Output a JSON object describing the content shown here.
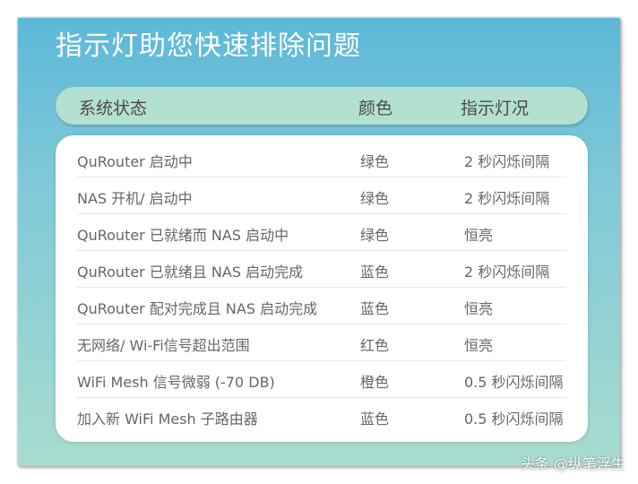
{
  "title": "指示灯助您快速排除问题",
  "header": {
    "col1": "系统状态",
    "col2": "颜色",
    "col3": "指示灯况"
  },
  "rows": [
    {
      "status": "QuRouter 启动中",
      "color": "绿色",
      "light": "2 秒闪烁间隔"
    },
    {
      "status": "NAS 开机/ 启动中",
      "color": "绿色",
      "light": "2 秒闪烁间隔"
    },
    {
      "status": "QuRouter 已就绪而 NAS 启动中",
      "color": "绿色",
      "light": "恒亮"
    },
    {
      "status": "QuRouter 已就绪且 NAS 启动完成",
      "color": "蓝色",
      "light": "2 秒闪烁间隔"
    },
    {
      "status": "QuRouter 配对完成且 NAS 启动完成",
      "color": "蓝色",
      "light": "恒亮"
    },
    {
      "status": "无网络/ Wi-Fi信号超出范围",
      "color": "红色",
      "light": "恒亮"
    },
    {
      "status": "WiFi Mesh 信号微弱 (-70 DB)",
      "color": "橙色",
      "light": "0.5 秒闪烁间隔"
    },
    {
      "status": "加入新 WiFi Mesh 子路由器",
      "color": "蓝色",
      "light": "0.5 秒闪烁间隔"
    }
  ],
  "watermark": "头条 @纵笔浮生",
  "colors": {
    "gradient_top": "#5cb8d8",
    "gradient_bottom": "#a8dccf",
    "header_bar": "#b4e0cf",
    "text": "#666666"
  }
}
